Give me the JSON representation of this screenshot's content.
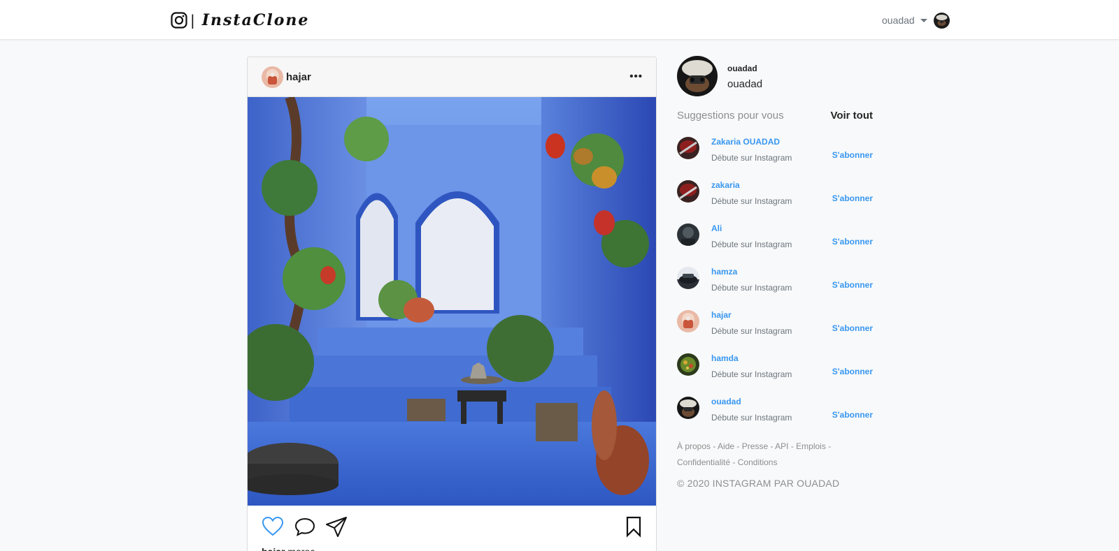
{
  "navbar": {
    "brand_separator": "|",
    "brand_name": "InstaClone",
    "username": "ouadad"
  },
  "post": {
    "username": "hajar",
    "more_label": "•••",
    "caption_user": "hajar",
    "caption_text": "maroc",
    "image_subject": "blue painted courtyard with plants and arch"
  },
  "sidebar": {
    "handle": "ouadad",
    "name": "ouadad",
    "suggestions_title": "Suggestions pour vous",
    "see_all": "Voir tout",
    "suggestions": [
      {
        "name": "Zakaria OUADAD",
        "subtitle": "Débute sur Instagram",
        "action": "S'abonner"
      },
      {
        "name": "zakaria",
        "subtitle": "Débute sur Instagram",
        "action": "S'abonner"
      },
      {
        "name": "Ali",
        "subtitle": "Débute sur Instagram",
        "action": "S'abonner"
      },
      {
        "name": "hamza",
        "subtitle": "Débute sur Instagram",
        "action": "S'abonner"
      },
      {
        "name": "hajar",
        "subtitle": "Débute sur Instagram",
        "action": "S'abonner"
      },
      {
        "name": "hamda",
        "subtitle": "Débute sur Instagram",
        "action": "S'abonner"
      },
      {
        "name": "ouadad",
        "subtitle": "Débute sur Instagram",
        "action": "S'abonner"
      }
    ],
    "footer_links": [
      "À propos",
      "Aide",
      "Presse",
      "API",
      "Emplois",
      "Confidentialité",
      "Conditions"
    ],
    "footer_separator": "-",
    "copyright": "© 2020 INSTAGRAM PAR OUADAD"
  },
  "colors": {
    "accent": "#3897f0",
    "like_outline": "#3897f0",
    "page_bg": "#f8f9fa"
  },
  "icons": {
    "brand": "instagram-icon",
    "like": "heart-icon",
    "comment": "comment-icon",
    "share": "paper-plane-icon",
    "save": "bookmark-icon"
  }
}
